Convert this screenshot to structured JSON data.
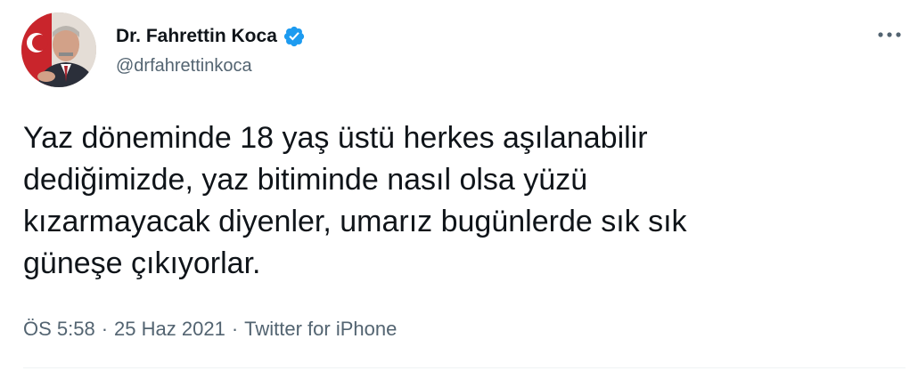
{
  "author": {
    "display_name": "Dr. Fahrettin Koca",
    "handle": "@drfahrettinkoca",
    "verified": true
  },
  "tweet": {
    "text": "Yaz döneminde 18 yaş üstü herkes aşılanabilir\ndediğimizde, yaz bitiminde nasıl olsa yüzü\nkızarmayacak diyenler, umarız bugünlerde sık sık\ngüneşe çıkıyorlar.",
    "time": "ÖS 5:58",
    "date": "25 Haz 2021",
    "source": "Twitter for iPhone",
    "separator": "·"
  },
  "icons": {
    "verified": "verified-badge-icon",
    "more": "more-options-icon"
  },
  "colors": {
    "text_primary": "#0f1419",
    "text_secondary": "#536471",
    "verified_blue": "#1d9bf0",
    "divider": "#eff3f4"
  }
}
